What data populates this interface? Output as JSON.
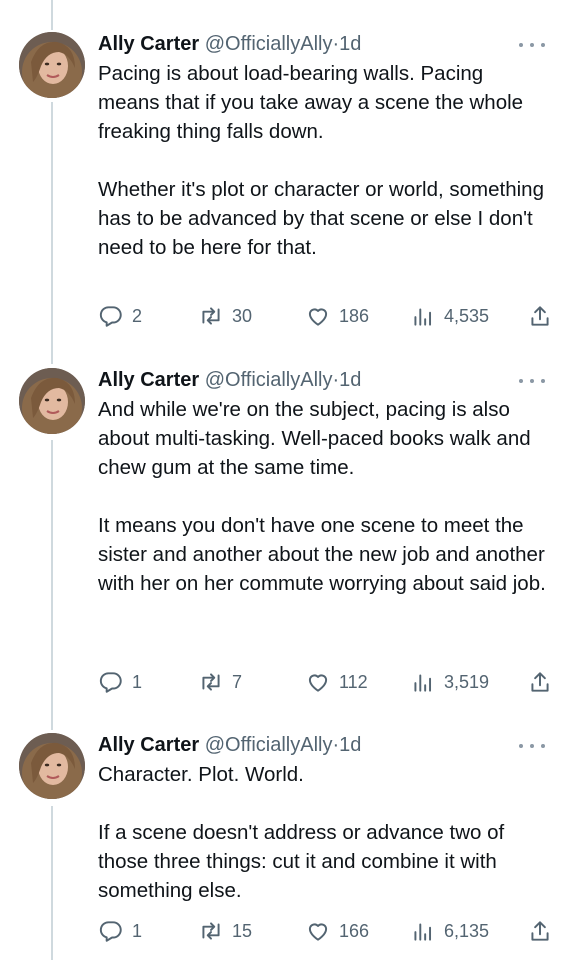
{
  "tweets": [
    {
      "author": "Ally Carter",
      "handle": "@OfficiallyAlly",
      "separator": "·",
      "time": "1d",
      "paragraphs": [
        "Pacing is about load-bearing walls. Pacing means that if you take away a scene the whole freaking thing falls down.",
        "Whether it's plot or character or world, something has to be advanced by that scene or else I don't need to be here for that."
      ],
      "replies": "2",
      "retweets": "30",
      "likes": "186",
      "views": "4,535"
    },
    {
      "author": "Ally Carter",
      "handle": "@OfficiallyAlly",
      "separator": "·",
      "time": "1d",
      "paragraphs": [
        "And while we're on the subject, pacing is also about multi-tasking. Well-paced books walk and chew gum at the same time.",
        "It means you don't have one scene to meet the sister and another about the new job and another with her on her commute worrying about said job."
      ],
      "replies": "1",
      "retweets": "7",
      "likes": "112",
      "views": "3,519"
    },
    {
      "author": "Ally Carter",
      "handle": "@OfficiallyAlly",
      "separator": "·",
      "time": "1d",
      "paragraphs": [
        "Character. Plot. World.",
        "If a scene doesn't address or advance two of those three things: cut it and combine it with something else."
      ],
      "replies": "1",
      "retweets": "15",
      "likes": "166",
      "views": "6,135"
    }
  ],
  "icons": {
    "reply": "reply-icon",
    "retweet": "retweet-icon",
    "like": "heart-icon",
    "views": "views-icon",
    "share": "share-icon",
    "more": "more-icon"
  },
  "colors": {
    "text": "#0f1419",
    "secondary": "#536471",
    "thread_line": "#cfd9de"
  }
}
